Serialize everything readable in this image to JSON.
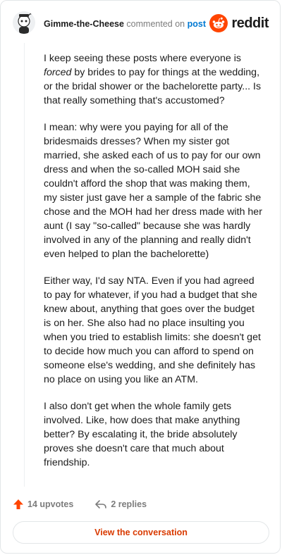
{
  "header": {
    "username": "Gimme-the-Cheese",
    "commented_on": "commented on",
    "post_link": "post",
    "brand_word": "reddit",
    "avatar_icon": "snoo-avatar-icon",
    "brand_icon": "reddit-logo-icon"
  },
  "comment": {
    "p1_before": "I keep seeing these posts where everyone is ",
    "p1_em": "forced",
    "p1_after": " by brides to pay for things at the wedding, or the bridal shower or the bachelorette party... Is that really something that's accustomed?",
    "p2": "I mean: why were you paying for all of the bridesmaids dresses? When my sister got married, she asked each of us to pay for our own dress and when the so-called MOH said she couldn't afford the shop that was making them, my sister just gave her a sample of the fabric she chose and the MOH had her dress made with her aunt (I say \"so-called\" because she was hardly involved in any of the planning and really didn't even helped to plan the bachelorette)",
    "p3": "Either way, I'd say NTA. Even if you had agreed to pay for whatever, if you had a budget that she knew about, anything that goes over the budget is on her. She also had no place insulting you when you tried to establish limits: she doesn't get to decide how much you can afford to spend on someone else's wedding, and she definitely has no place on using you like an ATM.",
    "p4": "I also don't get when the whole family gets involved. Like, how does that make anything better? By escalating it, the bride absolutely proves she doesn't care that much about friendship."
  },
  "footer": {
    "upvotes_label": "14 upvotes",
    "replies_label": "2 replies",
    "upvote_icon": "upvote-arrow-icon",
    "reply_icon": "reply-arrow-icon",
    "cta_label": "View the conversation"
  },
  "colors": {
    "accent": "#d93a00",
    "brand": "#ff4500",
    "link": "#0079d3",
    "muted": "#7c7c7c"
  }
}
